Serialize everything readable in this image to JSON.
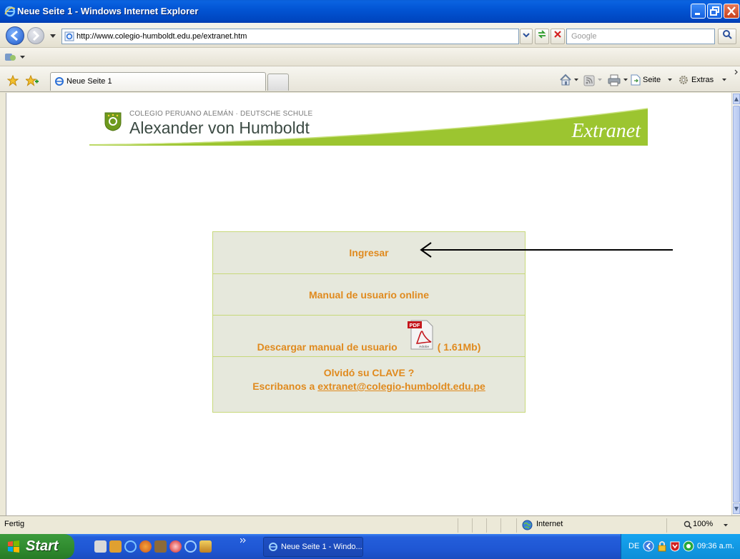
{
  "window": {
    "title": "Neue Seite 1 - Windows Internet Explorer",
    "controls": [
      "minimize",
      "maximize",
      "close"
    ]
  },
  "address_bar": {
    "url": "http://www.colegio-humboldt.edu.pe/extranet.htm",
    "search_placeholder": "Google"
  },
  "tabs": [
    {
      "label": "Neue Seite 1",
      "active": true
    }
  ],
  "command_bar": {
    "seite_label": "Seite",
    "extras_label": "Extras"
  },
  "page": {
    "header_small": "COLEGIO PERUANO ALEMÁN · DEUTSCHE SCHULE",
    "header_big": "Alexander von Humboldt",
    "header_right": "Extranet",
    "menu": {
      "ingresar": "Ingresar",
      "manual_online": "Manual de usuario online",
      "descargar": "Descargar manual de usuario",
      "size": "( 1.61Mb)",
      "olvido": "Olvidó su CLAVE ?",
      "escribanos": "Escribanos a",
      "email": "extranet@colegio-humboldt.edu.pe"
    },
    "pdf_icon_label": "PDF",
    "pdf_icon_sublabel": "Adobe"
  },
  "status_bar": {
    "status": "Fertig",
    "zone": "Internet",
    "zoom": "100%"
  },
  "taskbar": {
    "start_label": "Start",
    "task_label": "Neue Seite 1 - Windo...",
    "language": "DE",
    "clock": "09:36 a.m."
  },
  "colors": {
    "link_orange": "#e08a1e",
    "menu_bg": "#e6e8dc",
    "menu_border": "#c7d87a",
    "banner_green": "#9cc530"
  }
}
